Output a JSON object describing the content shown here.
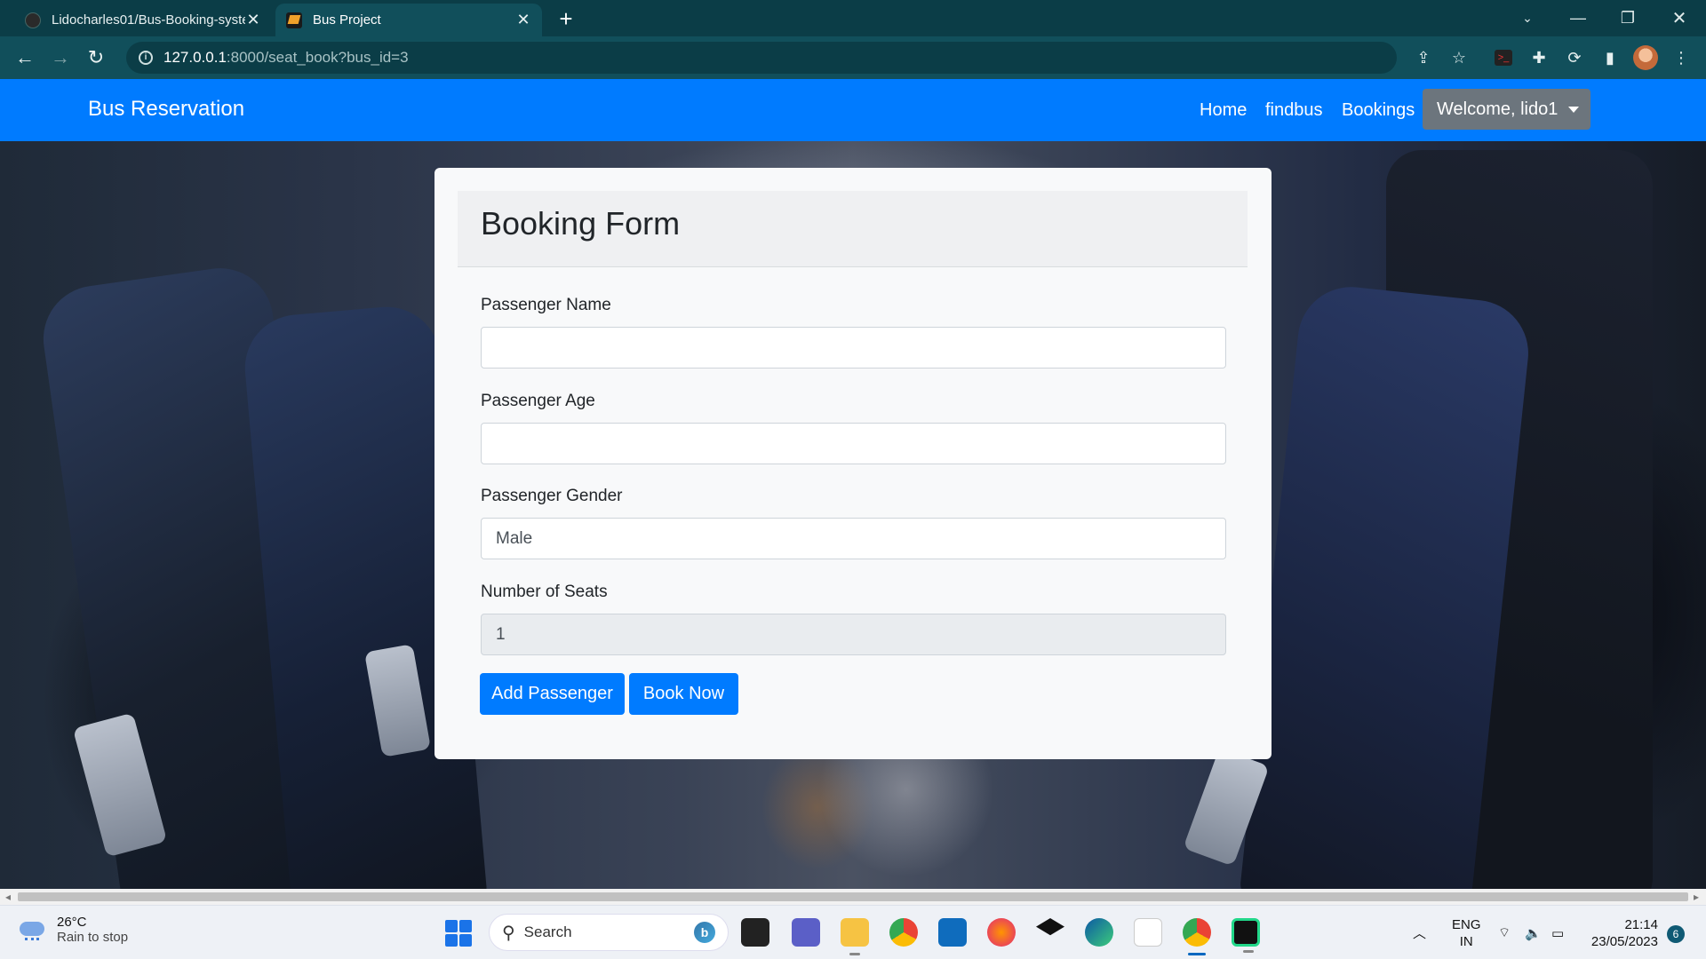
{
  "browser": {
    "tabs": [
      {
        "title": "Lidocharles01/Bus-Booking-syste",
        "active": false
      },
      {
        "title": "Bus Project",
        "active": true
      }
    ],
    "url": {
      "host": "127.0.0.1",
      "path": ":8000/seat_book?bus_id=3"
    }
  },
  "navbar": {
    "brand": "Bus Reservation",
    "links": [
      "Home",
      "findbus",
      "Bookings"
    ],
    "user_menu": "Welcome, lido1"
  },
  "form": {
    "title": "Booking Form",
    "fields": {
      "name": {
        "label": "Passenger Name",
        "value": ""
      },
      "age": {
        "label": "Passenger Age",
        "value": ""
      },
      "gender": {
        "label": "Passenger Gender",
        "value": "Male"
      },
      "seats": {
        "label": "Number of Seats",
        "value": "1"
      }
    },
    "buttons": {
      "add": "Add Passenger",
      "book": "Book Now"
    }
  },
  "taskbar": {
    "weather": {
      "temp": "26°C",
      "condition": "Rain to stop"
    },
    "search_placeholder": "Search",
    "language": {
      "line1": "ENG",
      "line2": "IN"
    },
    "clock": {
      "time": "21:14",
      "date": "23/05/2023"
    },
    "notification_count": "6"
  }
}
